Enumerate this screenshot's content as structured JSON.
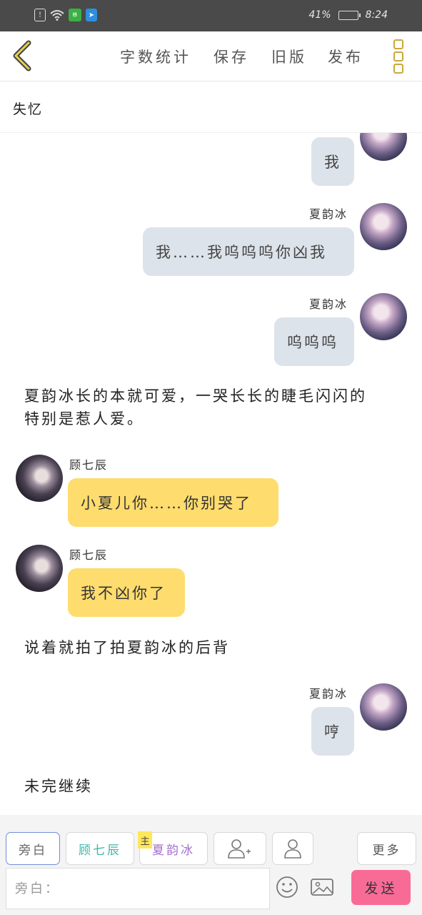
{
  "status_bar": {
    "battery_percent": "41%",
    "time": "8:24",
    "icons": [
      "alert-icon",
      "wifi-icon",
      "sim-icon",
      "app-icon"
    ]
  },
  "toolbar": {
    "back_icon": "chevron-left-icon",
    "word_count": "字数统计",
    "save": "保存",
    "old_version": "旧版",
    "publish": "发布",
    "menu_icon": "three-square-menu-icon",
    "accent_color": "#c8a93a"
  },
  "title": "失忆",
  "messages": [
    {
      "side": "right",
      "name": "",
      "text": "我"
    },
    {
      "side": "right",
      "name": "夏韵冰",
      "text": "我……我呜呜呜你凶我"
    },
    {
      "side": "right",
      "name": "夏韵冰",
      "text": "呜呜呜"
    },
    {
      "side": "narration",
      "text_line1": "夏韵冰长的本就可爱，一哭长长的睫毛闪闪的",
      "text_line2": "特别是惹人爱。"
    },
    {
      "side": "left",
      "name": "顾七辰",
      "text": "小夏儿你……你别哭了"
    },
    {
      "side": "left",
      "name": "顾七辰",
      "text": "我不凶你了"
    },
    {
      "side": "narration",
      "text_line1": "说着就拍了拍夏韵冰的后背"
    },
    {
      "side": "right",
      "name": "夏韵冰",
      "text": "哼"
    },
    {
      "side": "narration",
      "text_line1": "未完继续"
    }
  ],
  "bottom": {
    "role_narrator": "旁白",
    "role_1": "顾七辰",
    "role_2": "夏韵冰",
    "main_tag": "主",
    "more": "更多",
    "input_placeholder": "旁白：",
    "send": "发送",
    "colors": {
      "role_1": "#3fb6a8",
      "role_2": "#a56fd0",
      "send_bg": "#f96b97",
      "narrator_border": "#6f8fd8"
    }
  }
}
